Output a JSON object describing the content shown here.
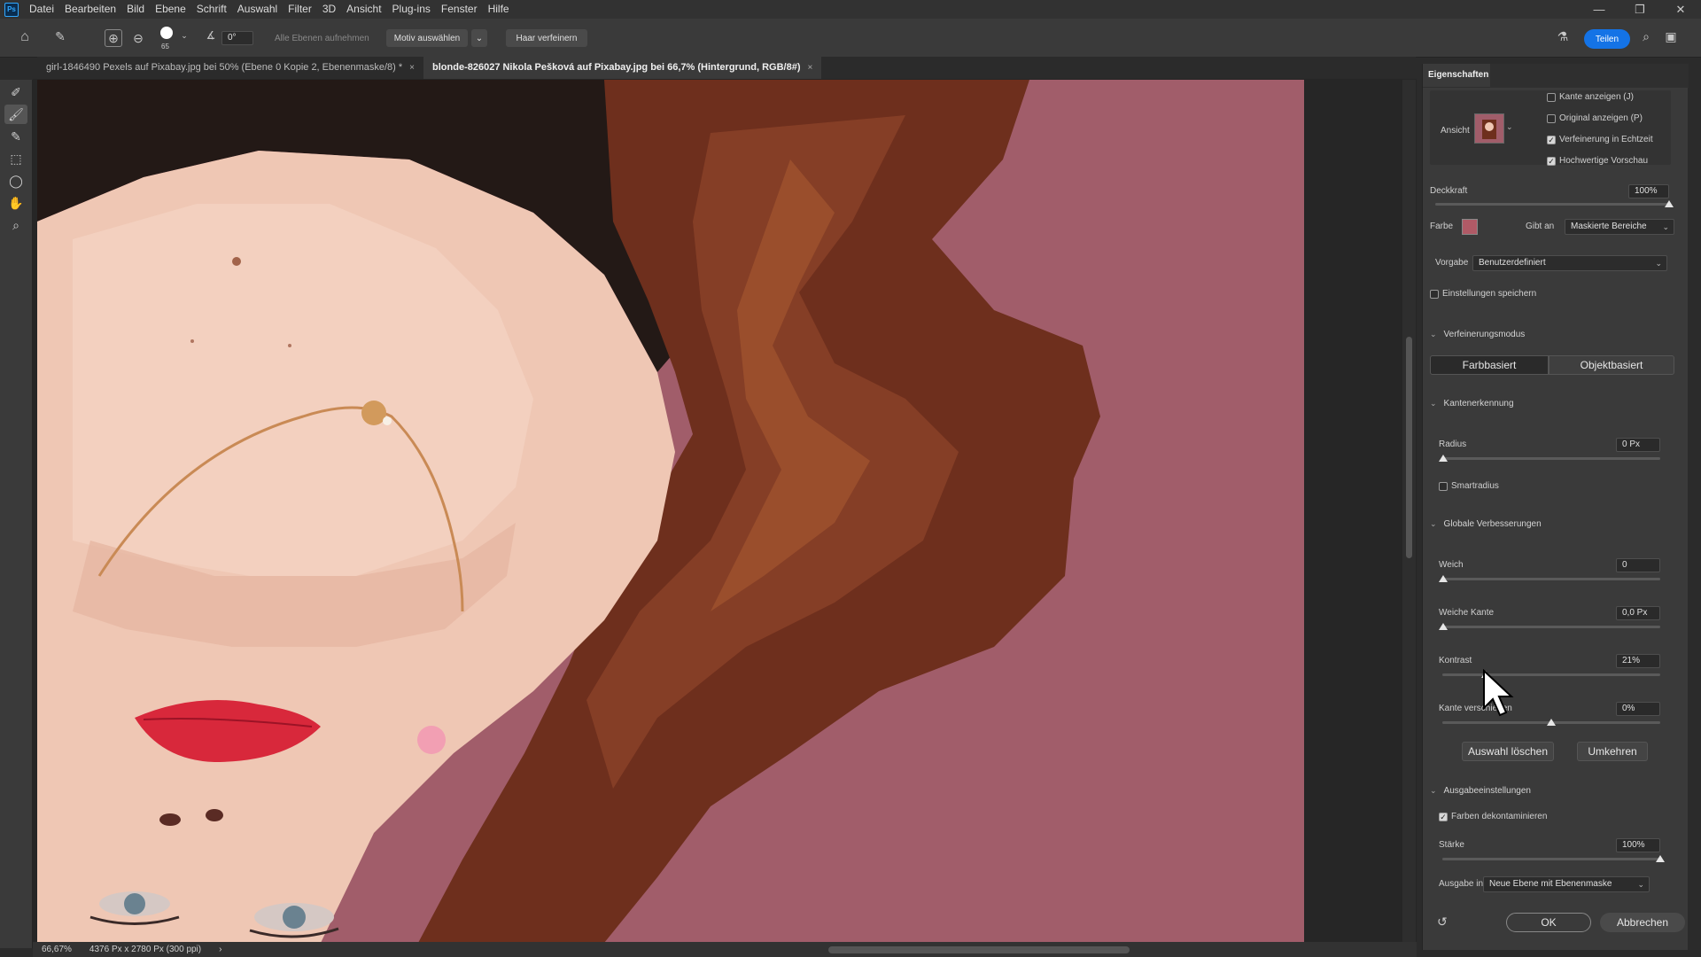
{
  "app": {
    "logo": "Ps"
  },
  "menu": [
    "Datei",
    "Bearbeiten",
    "Bild",
    "Ebene",
    "Schrift",
    "Auswahl",
    "Filter",
    "3D",
    "Ansicht",
    "Plug-ins",
    "Fenster",
    "Hilfe"
  ],
  "window_controls": {
    "minimize": "—",
    "restore": "❐",
    "close": "✕"
  },
  "options": {
    "brush_size": "65",
    "angle": "0°",
    "all_layers": "Alle Ebenen aufnehmen",
    "select_subject": "Motiv auswählen",
    "refine_hair": "Haar verfeinern",
    "share": "Teilen"
  },
  "tabs": [
    {
      "label": "girl-1846490 Pexels auf Pixabay.jpg bei 50% (Ebene 0 Kopie 2, Ebenenmaske/8) *",
      "close": "×"
    },
    {
      "label": "blonde-826027 Nikola Pešková auf Pixabay.jpg bei 66,7% (Hintergrund, RGB/8#)",
      "close": "×"
    }
  ],
  "status": {
    "zoom": "66,67%",
    "doc_info": "4376 Px x 2780 Px (300 ppi)",
    "arrow": "›"
  },
  "panel": {
    "title": "Eigenschaften",
    "view_label": "Ansicht",
    "checks": {
      "show_edge": {
        "label": "Kante anzeigen (J)",
        "checked": false
      },
      "show_original": {
        "label": "Original anzeigen (P)",
        "checked": false
      },
      "realtime": {
        "label": "Verfeinerung in Echtzeit",
        "checked": true
      },
      "hq_preview": {
        "label": "Hochwertige Vorschau",
        "checked": true
      }
    },
    "opacity": {
      "label": "Deckkraft",
      "value": "100%",
      "level": 1.0
    },
    "color": {
      "label": "Farbe",
      "swatch": "#b05a66",
      "indicates_label": "Gibt an",
      "indicates_value": "Maskierte Bereiche"
    },
    "preset": {
      "label": "Vorgabe",
      "value": "Benutzerdefiniert"
    },
    "save_settings": {
      "label": "Einstellungen speichern",
      "checked": false
    },
    "refine_mode": {
      "label": "Verfeinerungsmodus",
      "color_based": "Farbbasiert",
      "object_based": "Objektbasiert"
    },
    "edge_detection": {
      "label": "Kantenerkennung",
      "radius_label": "Radius",
      "radius_value": "0 Px",
      "radius_level": 0.0,
      "smart_radius": "Smartradius",
      "smart_checked": false
    },
    "global": {
      "label": "Globale Verbesserungen",
      "smooth_label": "Weich",
      "smooth_value": "0",
      "smooth_level": 0.0,
      "feather_label": "Weiche Kante",
      "feather_value": "0,0 Px",
      "feather_level": 0.0,
      "contrast_label": "Kontrast",
      "contrast_value": "21%",
      "contrast_level": 0.21,
      "shift_label": "Kante verschieben",
      "shift_value": "0%",
      "shift_level": 0.5,
      "clear_selection": "Auswahl löschen",
      "invert": "Umkehren"
    },
    "output": {
      "label": "Ausgabeeinstellungen",
      "decontaminate": "Farben dekontaminieren",
      "decontaminate_checked": true,
      "strength_label": "Stärke",
      "strength_value": "100%",
      "strength_level": 1.0,
      "output_to_label": "Ausgabe in",
      "output_to_value": "Neue Ebene mit Ebenenmaske"
    },
    "ok": "OK",
    "cancel": "Abbrechen"
  },
  "colors": {
    "accent": "#1473e6",
    "background_pink": "#a15d6a"
  }
}
